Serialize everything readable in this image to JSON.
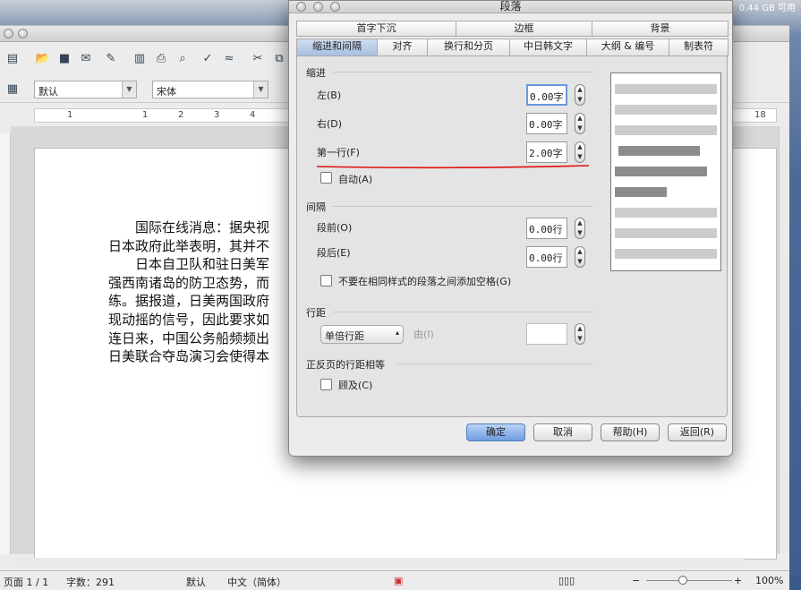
{
  "menubar": {
    "status": "0.44 GB 可用"
  },
  "writer": {
    "styles_combo": "默认",
    "font_combo": "宋体",
    "ruler_numbers": [
      "1",
      "1",
      "2",
      "3",
      "4",
      "18"
    ],
    "doc_lines": [
      "国际在线消息：据央视",
      "日本政府此举表明，其并不",
      "日本自卫队和驻日美军",
      "强西南诸岛的防卫态势，而",
      "练。据报道，日美两国政府",
      "现动摇的信号，因此要求如",
      "连日来，中国公务船频频出",
      "日美联合夺岛演习会使得本"
    ]
  },
  "statusbar": {
    "page": "页面 1 / 1",
    "words": "字数：291",
    "style": "默认",
    "language": "中文（简体）",
    "zoom": "100%"
  },
  "dialog": {
    "title": "段落",
    "tabs_row1": [
      "首字下沉",
      "边框",
      "背景"
    ],
    "tabs_row2": [
      "缩进和间隔",
      "对齐",
      "换行和分页",
      "中日韩文字",
      "大纲 & 编号",
      "制表符"
    ],
    "active_tab": "缩进和间隔",
    "indent": {
      "heading": "缩进",
      "left_label": "左(B)",
      "left_value": "0.00字",
      "right_label": "右(D)",
      "right_value": "0.00字",
      "first_label": "第一行(F)",
      "first_value": "2.00字",
      "auto_label": "自动(A)"
    },
    "spacing": {
      "heading": "间隔",
      "before_label": "段前(O)",
      "before_value": "0.00行",
      "after_label": "段后(E)",
      "after_value": "0.00行",
      "no_space_label": "不要在相同样式的段落之间添加空格(G)"
    },
    "line_spacing": {
      "heading": "行距",
      "value": "单倍行距",
      "by_label": "由(I)"
    },
    "register": {
      "heading": "正反页的行距相等",
      "activate_label": "顾及(C)"
    },
    "buttons": {
      "ok": "确定",
      "cancel": "取消",
      "help": "帮助(H)",
      "reset": "返回(R)"
    }
  },
  "colors": {
    "highlight": "#e01010",
    "tab_active": "#a9bfe0"
  }
}
